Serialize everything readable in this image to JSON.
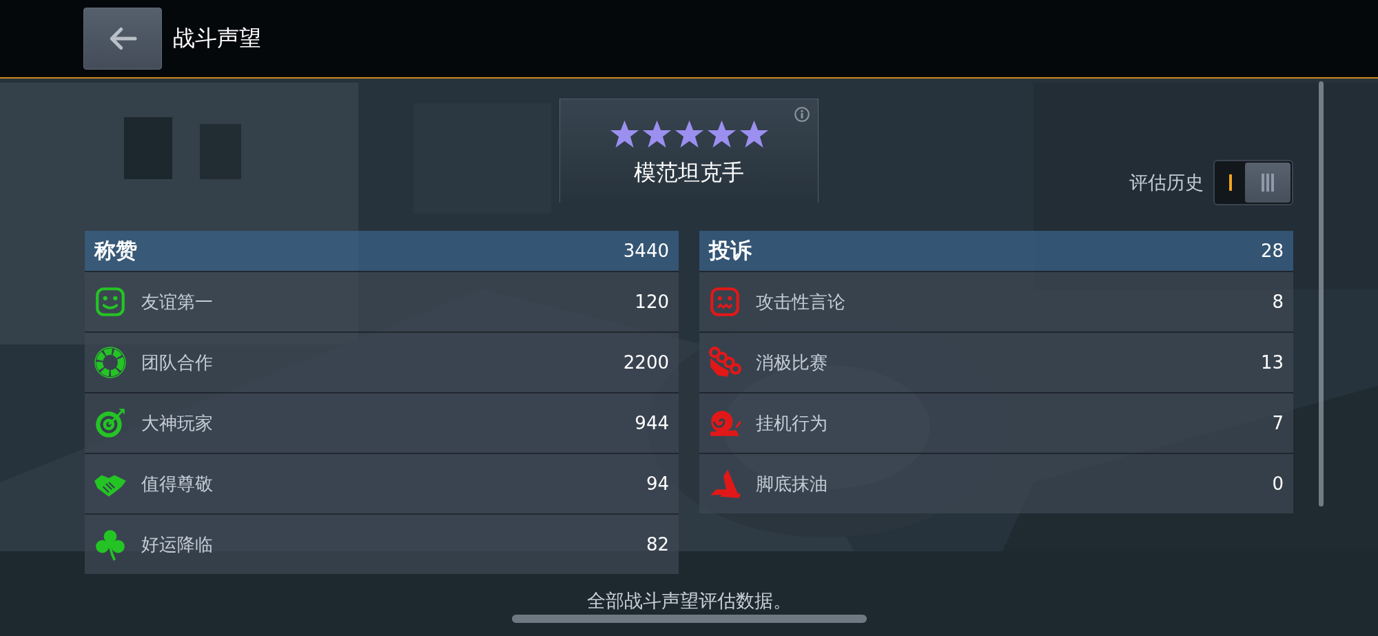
{
  "header": {
    "title": "战斗声望"
  },
  "rating": {
    "stars": 5,
    "title": "模范坦克手"
  },
  "history_toggle": {
    "label": "评估历史",
    "options": [
      {
        "kind": "single",
        "selected": false
      },
      {
        "kind": "multi",
        "selected": true
      }
    ]
  },
  "panels": [
    {
      "title": "称赞",
      "count": "3440",
      "color": "#24c424",
      "rows": [
        {
          "kind": "smile",
          "label": "友谊第一",
          "value": "120"
        },
        {
          "kind": "ring",
          "label": "团队合作",
          "value": "2200"
        },
        {
          "kind": "target",
          "label": "大神玩家",
          "value": "944"
        },
        {
          "kind": "handshake",
          "label": "值得尊敬",
          "value": "94"
        },
        {
          "kind": "clover",
          "label": "好运降临",
          "value": "82"
        }
      ]
    },
    {
      "title": "投诉",
      "count": "28",
      "color": "#e21818",
      "rows": [
        {
          "kind": "frown",
          "label": "攻击性言论",
          "value": "8"
        },
        {
          "kind": "knuckles",
          "label": "消极比赛",
          "value": "13"
        },
        {
          "kind": "snail",
          "label": "挂机行为",
          "value": "7"
        },
        {
          "kind": "flee",
          "label": "脚底抹油",
          "value": "0"
        }
      ]
    }
  ],
  "footer_note": "全部战斗声望评估数据。"
}
